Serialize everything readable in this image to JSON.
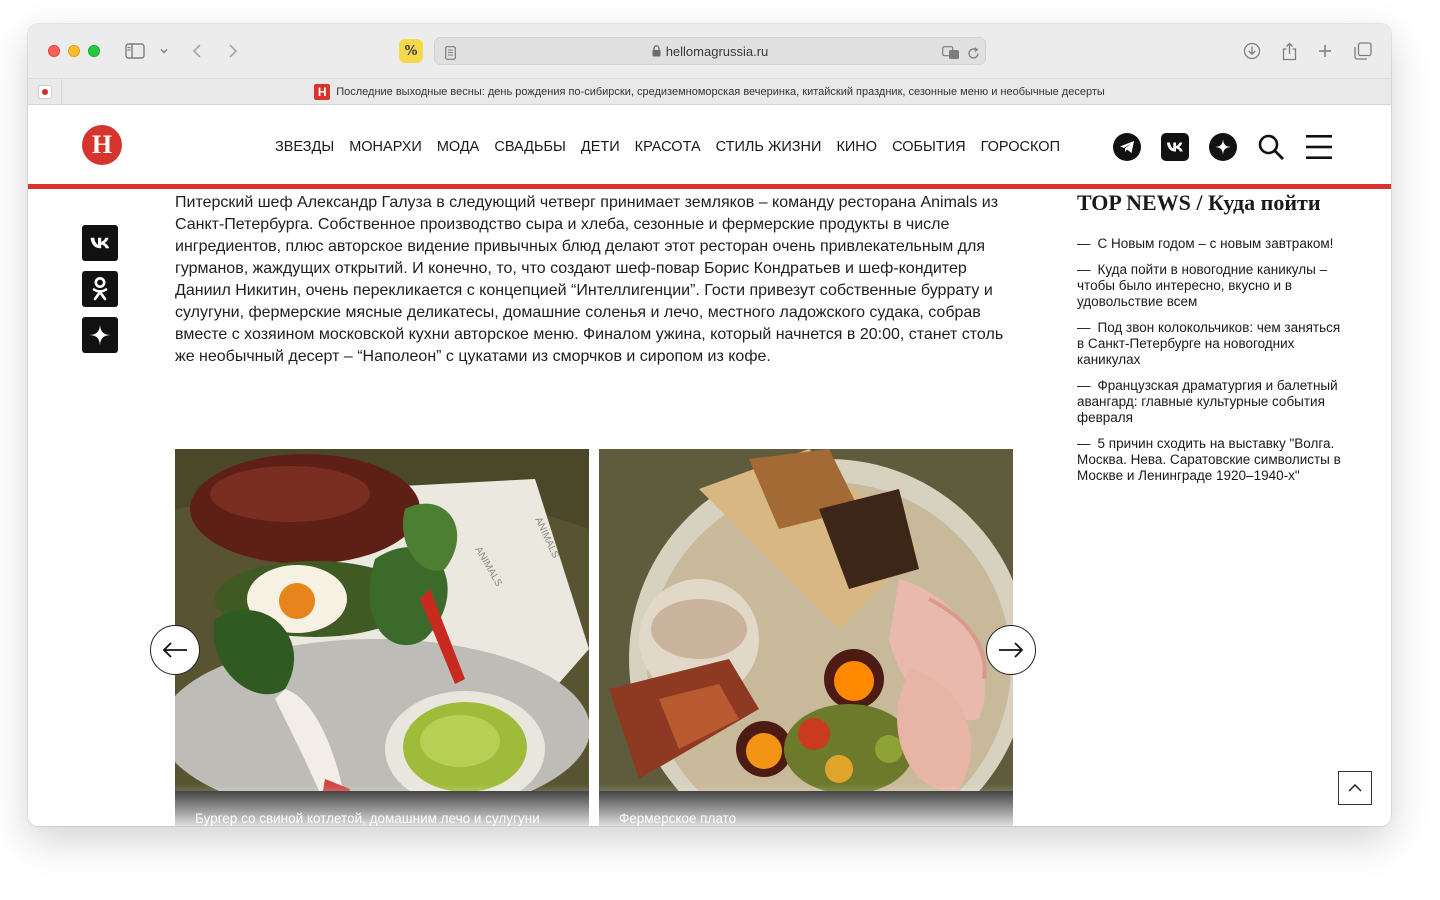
{
  "browser": {
    "url": "hellomagrussia.ru",
    "tab_title": "Последние выходные весны: день рождения по-сибирски, средиземноморская вечеринка, китайский праздник, сезонные меню и необычные десерты",
    "tab_favicon": "H",
    "extension_label": "%"
  },
  "site": {
    "logo_letter": "H",
    "brand_color": "#d6342c",
    "nav": [
      "ЗВЕЗДЫ",
      "МОНАРХИ",
      "МОДА",
      "СВАДЬБЫ",
      "ДЕТИ",
      "КРАСОТА",
      "СТИЛЬ ЖИЗНИ",
      "КИНО",
      "СОБЫТИЯ",
      "ГОРОСКОП"
    ]
  },
  "share": {
    "vk": "VK",
    "ok": "OK",
    "zen": "Zen"
  },
  "article": {
    "body": "Питерский шеф Александр Галуза в следующий четверг принимает земляков – команду ресторана Animals из Санкт-Петербурга. Собственное производство сыра и хлеба, сезонные и фермерские продукты в числе ингредиентов, плюс авторское видение привычных блюд делают этот ресторан очень привлекательным для гурманов, жаждущих открытий. И конечно, то, что создают шеф-повар Борис Кондратьев и шеф-кондитер Даниил Никитин, очень перекликается с концепцией “Интеллигенции”. Гости привезут собственные буррату и сулугуни, фермерские мясные деликатесы, домашние соленья и лечо, местного ладожского судака, собрав вместе с хозяином московской кухни авторское меню. Финалом ужина, который начнется в 20:00, станет столь же необычный десерт – “Наполеон” с цукатами из сморчков и сиропом из кофе."
  },
  "gallery": {
    "slides": [
      {
        "caption": "Бургер со свиной котлетой, домашним лечо и сулугуни"
      },
      {
        "caption": "Фермерское плато"
      }
    ]
  },
  "sidebar": {
    "title": "TOP NEWS / Куда пойти",
    "items": [
      "С Новым годом – с новым завтраком!",
      "Куда пойти в новогодние каникулы – чтобы было интересно, вкусно и в удовольствие всем",
      "Под звон колокольчиков: чем заняться в Санкт-Петербурге на новогодних каникулах",
      "Французская драматургия и балетный авангард: главные культурные события февраля",
      "5 причин сходить на выставку \"Волга. Москва. Нева. Саратовские символисты в Москве и Ленинграде 1920–1940-х\""
    ]
  }
}
